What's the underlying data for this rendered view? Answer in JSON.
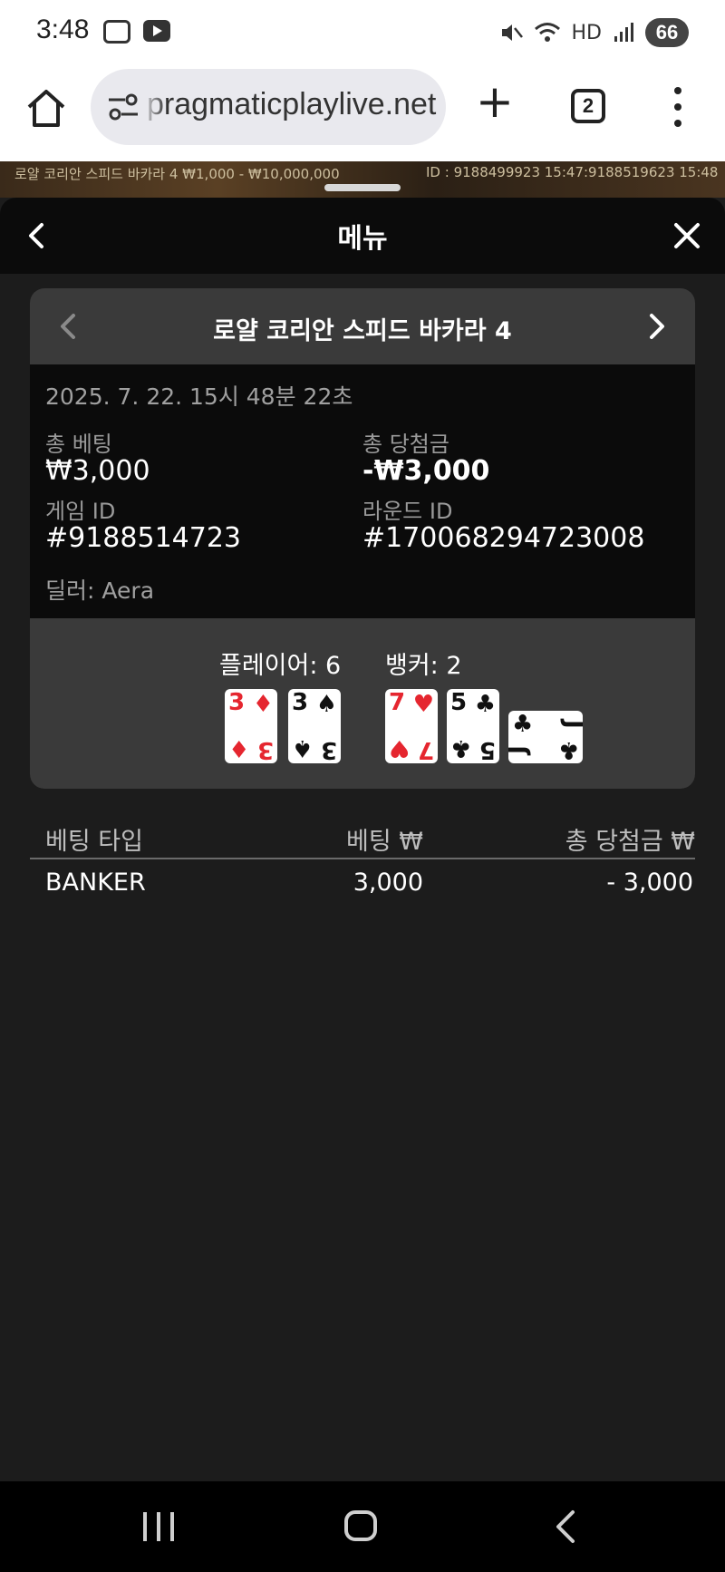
{
  "status_bar": {
    "time": "3:48",
    "battery": "66",
    "hd_label": "HD"
  },
  "browser": {
    "url": "pragmaticplaylive.net",
    "tab_count": "2"
  },
  "background_game": {
    "title": "로얄 코리안 스피드 바카라 4 ₩1,000 - ₩10,000,000",
    "id_text": "ID : 9188499923 15:47:9188519623 15:48"
  },
  "menu": {
    "title": "메뉴"
  },
  "round": {
    "game_name": "로얄 코리안 스피드 바카라 4",
    "datetime": "2025. 7. 22. 15시 48분 22초",
    "total_bet_label": "총 베팅",
    "total_bet_value": "₩3,000",
    "total_win_label": "총 당첨금",
    "total_win_value": "-₩3,000",
    "game_id_label": "게임 ID",
    "game_id_value": "#9188514723",
    "round_id_label": "라운드 ID",
    "round_id_value": "#170068294723008",
    "dealer": "딜러: Aera",
    "player_label": "플레이어: 6",
    "banker_label": "뱅커: 2",
    "player_cards": [
      {
        "rank": "3",
        "suit": "♦",
        "color": "#e5262f"
      },
      {
        "rank": "3",
        "suit": "♠",
        "color": "#111111"
      }
    ],
    "banker_cards": [
      {
        "rank": "7",
        "suit": "♥",
        "color": "#e5262f"
      },
      {
        "rank": "5",
        "suit": "♣",
        "color": "#111111"
      },
      {
        "rank": "J",
        "suit": "♣",
        "color": "#111111",
        "sideways": true
      }
    ]
  },
  "bets_table": {
    "headers": [
      "베팅 타입",
      "베팅 ₩",
      "총 당첨금 ₩"
    ],
    "rows": [
      [
        "BANKER",
        "3,000",
        "- 3,000"
      ]
    ]
  }
}
